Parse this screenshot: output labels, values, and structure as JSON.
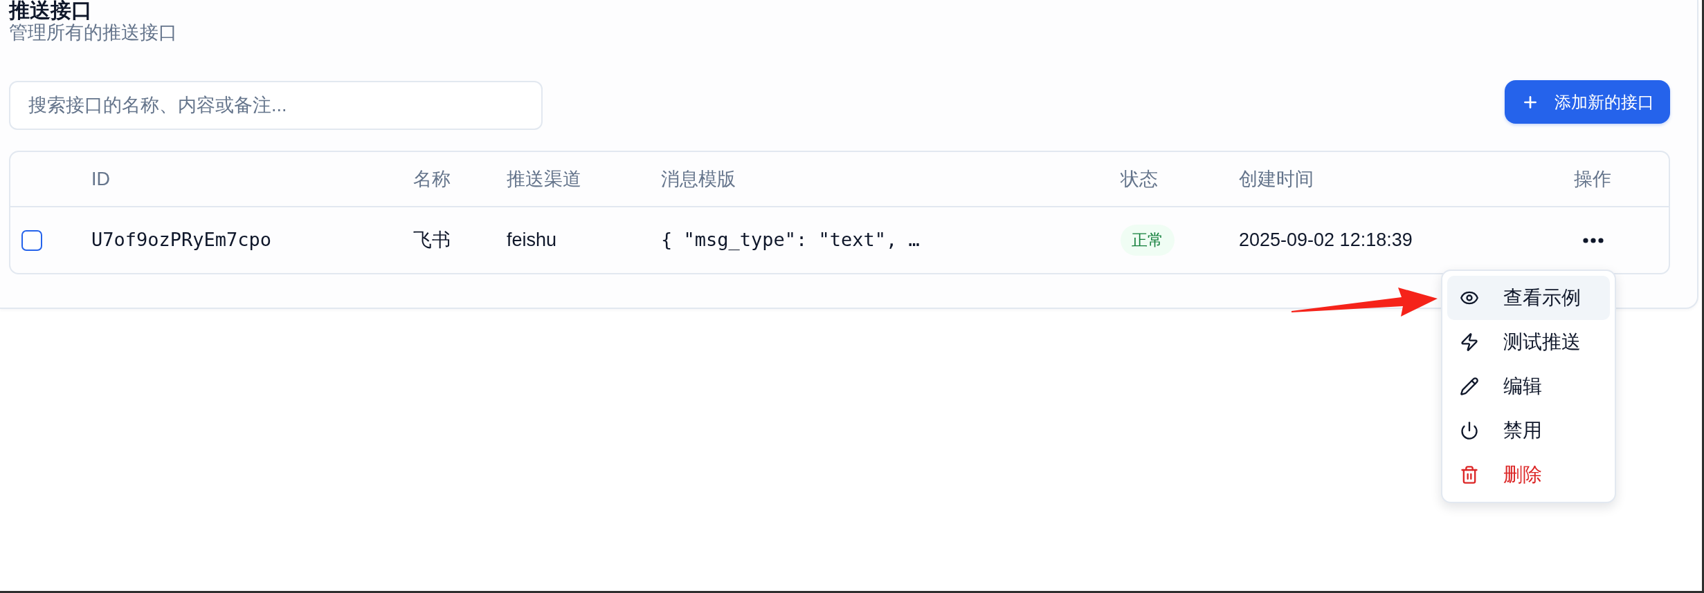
{
  "page": {
    "title": "推送接口",
    "subtitle": "管理所有的推送接口"
  },
  "search": {
    "placeholder": "搜索接口的名称、内容或备注..."
  },
  "add_button": {
    "label": "添加新的接口"
  },
  "table": {
    "columns": [
      "ID",
      "名称",
      "推送渠道",
      "消息模版",
      "状态",
      "创建时间",
      "操作"
    ],
    "rows": [
      {
        "checked": false,
        "id": "U7of9ozPRyEm7cpo",
        "name": "飞书",
        "channel": "feishu",
        "template": "{ \"msg_type\": \"text\", …",
        "status": {
          "label": "正常",
          "kind": "active"
        },
        "created": "2025-09-02 12:18:39",
        "menu_open": true
      }
    ]
  },
  "row_menu": {
    "items": [
      {
        "label": "查看示例",
        "selected": true,
        "danger": false
      },
      {
        "label": "测试推送",
        "selected": false,
        "danger": false
      },
      {
        "label": "编辑",
        "selected": false,
        "danger": false
      },
      {
        "label": "禁用",
        "selected": false,
        "danger": false
      },
      {
        "label": "删除",
        "selected": false,
        "danger": true
      }
    ]
  }
}
